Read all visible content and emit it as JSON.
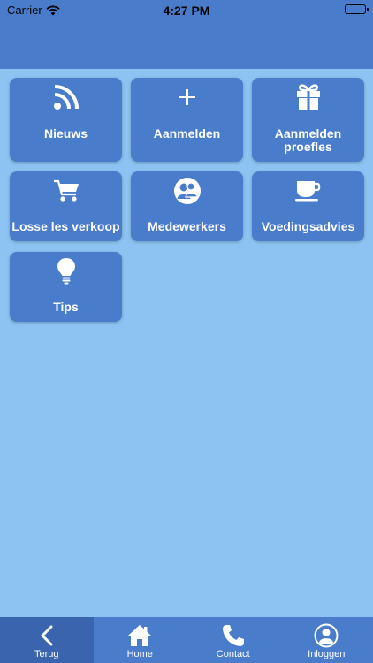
{
  "status_bar": {
    "carrier": "Carrier",
    "time": "4:27 PM"
  },
  "tiles": [
    {
      "label": "Nieuws",
      "icon": "rss-icon"
    },
    {
      "label": "Aanmelden",
      "icon": "plus-icon"
    },
    {
      "label": "Aanmelden proefles",
      "icon": "gift-icon"
    },
    {
      "label": "Losse les verkoop",
      "icon": "shopping-cart-icon"
    },
    {
      "label": "Medewerkers",
      "icon": "users-icon"
    },
    {
      "label": "Voedingsadvies",
      "icon": "coffee-cup-icon"
    },
    {
      "label": "Tips",
      "icon": "lightbulb-icon"
    }
  ],
  "tabbar": [
    {
      "label": "Terug",
      "icon": "chevron-left-icon",
      "active": true
    },
    {
      "label": "Home",
      "icon": "home-icon"
    },
    {
      "label": "Contact",
      "icon": "phone-icon"
    },
    {
      "label": "Inloggen",
      "icon": "user-icon"
    }
  ],
  "colors": {
    "background": "#8cc3f2",
    "primary": "#4a7ccc",
    "active_tab": "#3a65ae"
  }
}
